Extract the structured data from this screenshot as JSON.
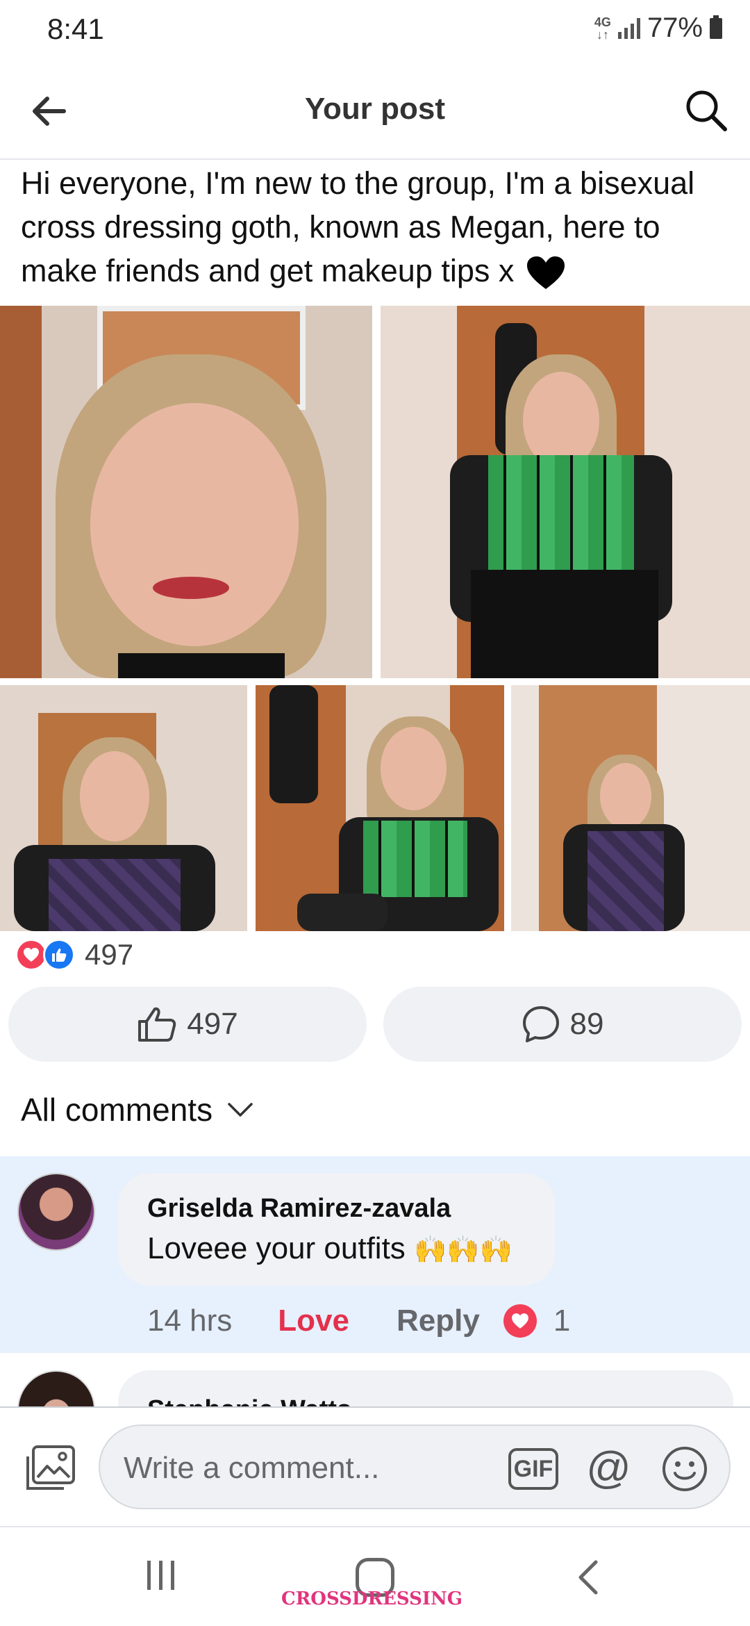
{
  "status_bar": {
    "time": "8:41",
    "network": "4G",
    "battery": "77%"
  },
  "header": {
    "title": "Your post"
  },
  "post": {
    "text": "Hi everyone, I'm new to the group, I'm a bisexual cross dressing goth, known as Megan, here to make friends and get makeup tips x",
    "emoji": "black-heart"
  },
  "reactions": {
    "count": "497",
    "types": [
      "love",
      "like"
    ]
  },
  "actions": {
    "like_count": "497",
    "comment_count": "89"
  },
  "comments_filter": {
    "label": "All comments"
  },
  "comments": [
    {
      "author": "Griselda Ramirez-zavala",
      "text": "Loveee your outfits",
      "time": "14 hrs",
      "love_label": "Love",
      "reply_label": "Reply",
      "reaction_count": "1"
    },
    {
      "author": "Stephanie Watts"
    }
  ],
  "composer": {
    "placeholder": "Write a comment...",
    "gif_label": "GIF",
    "at_label": "@"
  },
  "watermark": "CROSSDRESSING",
  "colors": {
    "love": "#f33e58",
    "like": "#1877f2",
    "highlight": "#e7f0fd",
    "love_text": "#e4304c"
  }
}
